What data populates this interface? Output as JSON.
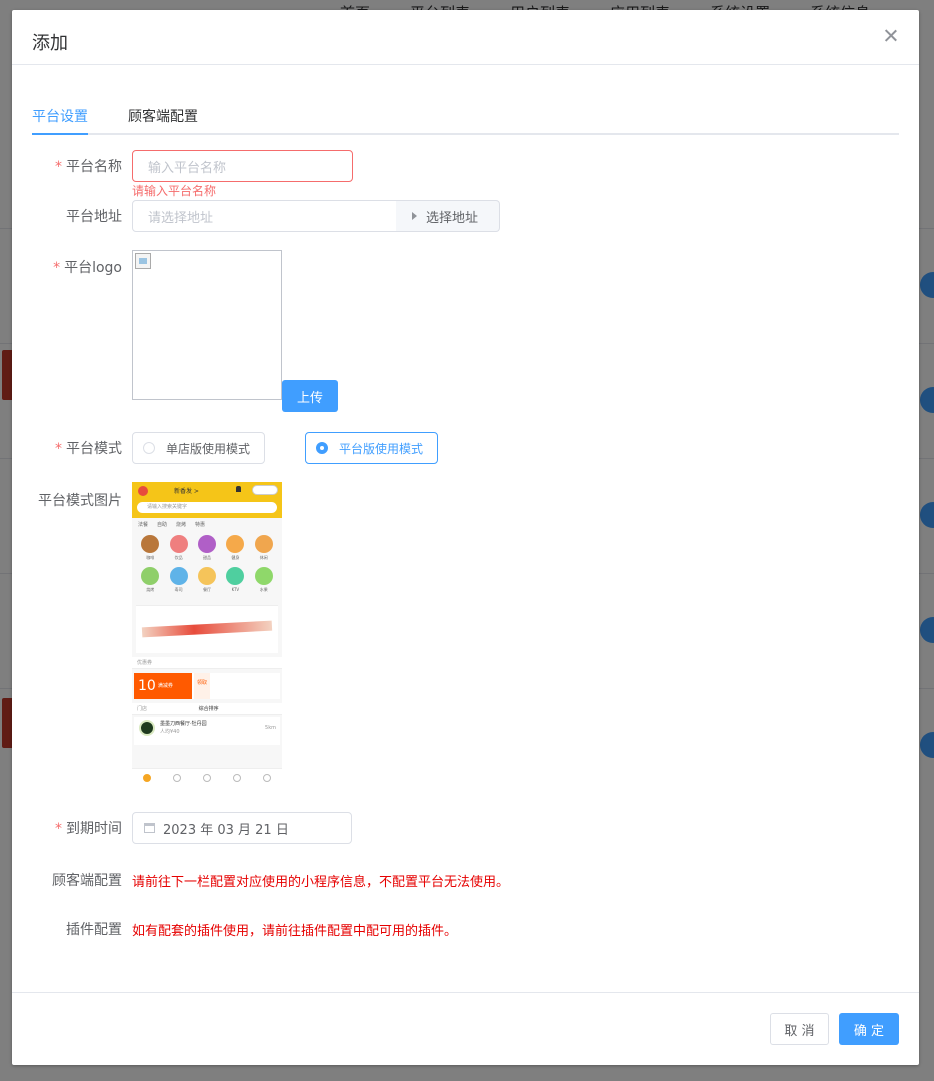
{
  "background": {
    "nav": [
      "首页",
      "平台列表",
      "用户列表",
      "应用列表",
      "系统设置",
      "系统信息"
    ]
  },
  "dialog": {
    "title": "添加",
    "tabs": [
      {
        "label": "平台设置",
        "active": true
      },
      {
        "label": "顾客端配置",
        "active": false
      }
    ],
    "form": {
      "platform_name": {
        "label": "平台名称",
        "placeholder": "输入平台名称",
        "error": "请输入平台名称"
      },
      "platform_address": {
        "label": "平台地址",
        "placeholder": "请选择地址",
        "button": "选择地址"
      },
      "platform_logo": {
        "label": "平台logo",
        "upload_button": "上传"
      },
      "platform_mode": {
        "label": "平台模式",
        "options": [
          {
            "label": "单店版使用模式",
            "checked": false
          },
          {
            "label": "平台版使用模式",
            "checked": true
          }
        ]
      },
      "mode_image": {
        "label": "平台模式图片",
        "preview": {
          "location": "新香发 >",
          "search_placeholder": "请输入搜索关键字",
          "categories": [
            "法餐",
            "自助",
            "烧烤",
            "特惠"
          ],
          "grid": [
            {
              "label": "咖啡",
              "color": "#b9773b"
            },
            {
              "label": "饮品",
              "color": "#ef7f7f"
            },
            {
              "label": "甜品",
              "color": "#b05fc7"
            },
            {
              "label": "健身",
              "color": "#f5a94a"
            },
            {
              "label": "休闲",
              "color": "#f0a64e"
            },
            {
              "label": "烧烤",
              "color": "#8fcf6a"
            },
            {
              "label": "寿司",
              "color": "#5fb3e8"
            },
            {
              "label": "餐厅",
              "color": "#f5c45a"
            },
            {
              "label": "KTV",
              "color": "#4fcf9f"
            },
            {
              "label": "水果",
              "color": "#8fd86a"
            }
          ],
          "coupon_section": "优惠券",
          "coupon_amount": "10",
          "coupon_text": "满减券",
          "coupon_side": "领取",
          "shop_section": "门店",
          "shop_sort": "综合排序",
          "shop_name": "墨墨刀西餐厅·牡丹园",
          "shop_meta": "人均¥40",
          "shop_distance": "5km"
        }
      },
      "expire_time": {
        "label": "到期时间",
        "value": "2023 年 03 月 21 日"
      },
      "client_config": {
        "label": "顾客端配置",
        "text": "请前往下一栏配置对应使用的小程序信息，不配置平台无法使用。"
      },
      "plugin_config": {
        "label": "插件配置",
        "text": "如有配套的插件使用，请前往插件配置中配可用的插件。"
      }
    },
    "footer": {
      "cancel": "取 消",
      "confirm": "确 定"
    }
  }
}
